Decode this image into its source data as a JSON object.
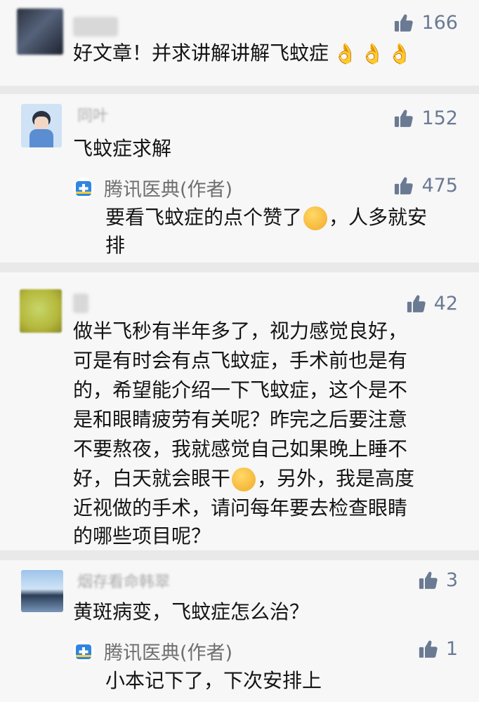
{
  "comments": [
    {
      "likes": "166",
      "text": "好文章！并求讲解讲解飞蚊症",
      "emoji": "👌"
    },
    {
      "likes": "152",
      "name": "同叶",
      "text": "飞蚊症求解",
      "reply": {
        "author": "腾讯医典(作者)",
        "likes": "475",
        "line1": "要看飞蚊症的点个赞了",
        "line1b": "，人多就安",
        "line2": "排"
      }
    },
    {
      "likes": "42",
      "lines": [
        "做半飞秒有半年多了，视力感觉良好，",
        "可是有时会有点飞蚊症，手术前也是有",
        "的，希望能介绍一下飞蚊症，这个是不",
        "是和眼睛疲劳有关呢？昨完之后要注意",
        "不要熬夜，我就感觉自己如果晚上睡不"
      ],
      "line6a": "好，白天就会眼干",
      "line6b": "，另外，我是高度",
      "lines_end": [
        "近视做的手术，请问每年要去检查眼睛",
        "的哪些项目呢？"
      ]
    },
    {
      "likes": "3",
      "name": "烟存看命韩翠",
      "text": "黄斑病变，飞蚊症怎么治？",
      "reply": {
        "author": "腾讯医典(作者)",
        "likes": "1",
        "line1": "小本记下了，下次安排上"
      }
    }
  ],
  "colors": {
    "accent": "#6b7a93",
    "background": "#f7f7f7",
    "divider": "#e9e9e9"
  }
}
